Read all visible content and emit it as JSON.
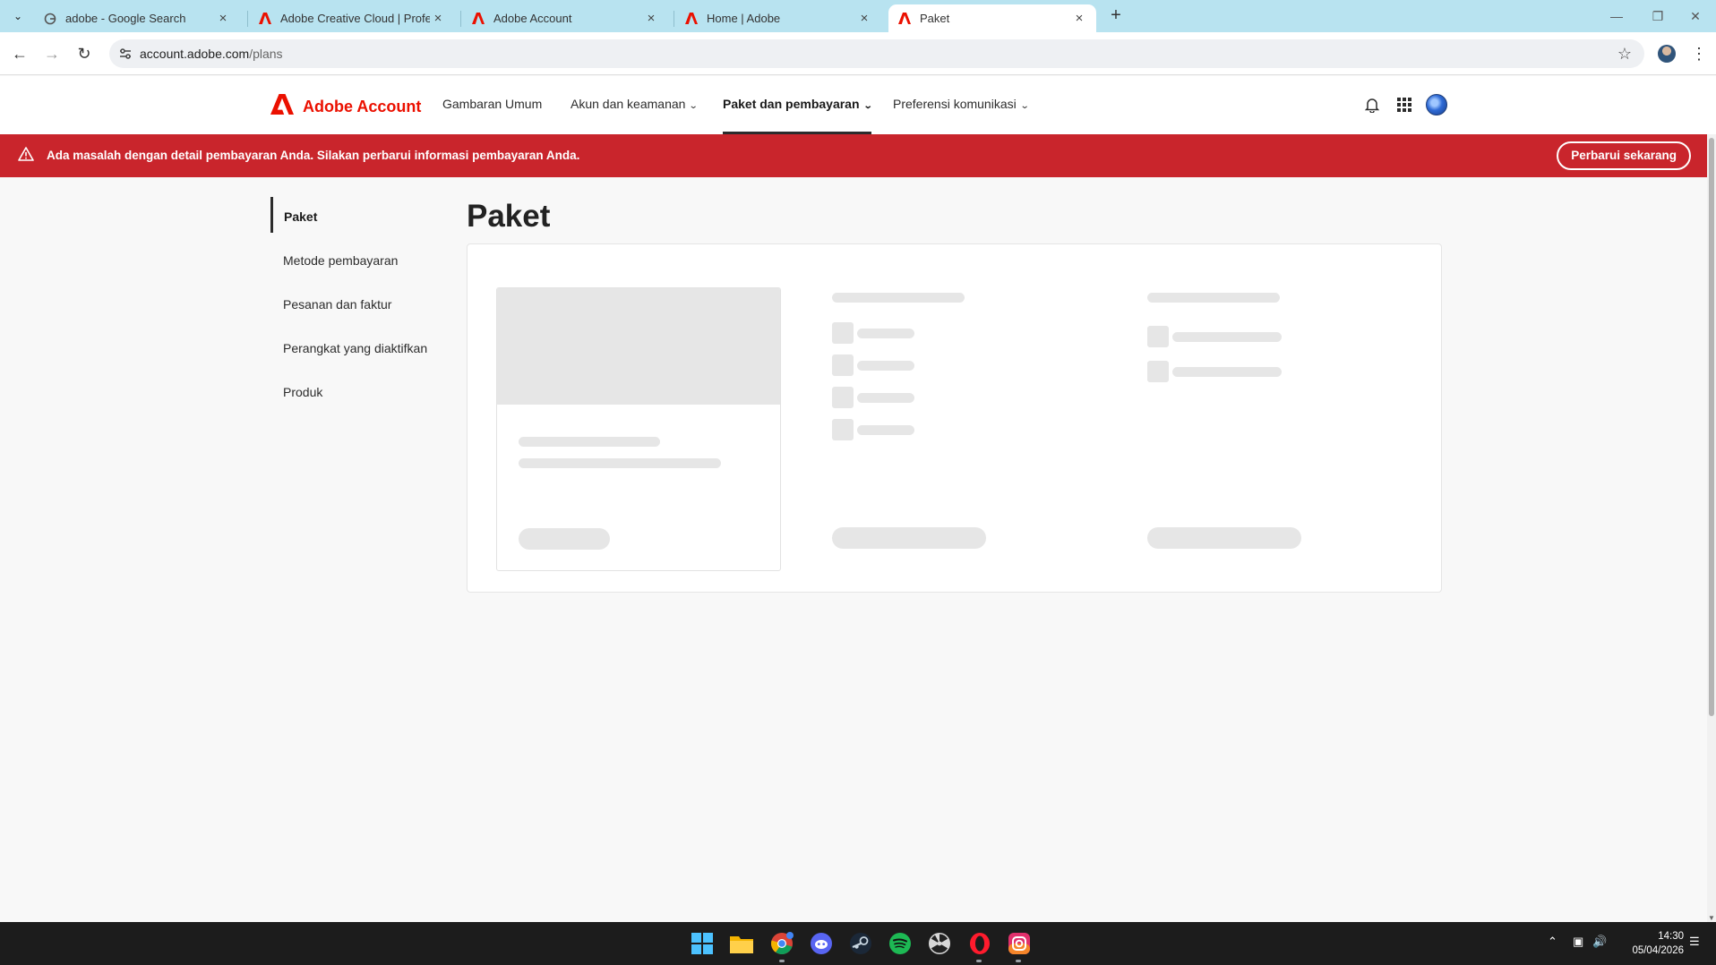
{
  "browser": {
    "tabs": [
      {
        "title": "adobe - Google Search",
        "favicon": "google-icon"
      },
      {
        "title": "Adobe Creative Cloud | Profess",
        "favicon": "adobe-icon"
      },
      {
        "title": "Adobe Account",
        "favicon": "adobe-icon"
      },
      {
        "title": "Home | Adobe",
        "favicon": "adobe-icon"
      },
      {
        "title": "Paket",
        "favicon": "adobe-icon",
        "active": true
      }
    ],
    "url_host": "account.adobe.com",
    "url_path": "/plans"
  },
  "header": {
    "brand": "Adobe Account",
    "nav": [
      {
        "label": "Gambaran Umum",
        "has_menu": false
      },
      {
        "label": "Akun dan keamanan",
        "has_menu": true
      },
      {
        "label": "Paket dan pembayaran",
        "has_menu": true,
        "active": true
      },
      {
        "label": "Preferensi komunikasi",
        "has_menu": true
      }
    ],
    "brand_color": "#eb1000"
  },
  "alert": {
    "message": "Ada masalah dengan detail pembayaran Anda. Silakan perbarui informasi pembayaran Anda.",
    "button": "Perbarui sekarang",
    "color": "#c9252c"
  },
  "sidebar": {
    "items": [
      {
        "label": "Paket",
        "active": true
      },
      {
        "label": "Metode pembayaran"
      },
      {
        "label": "Pesanan dan faktur"
      },
      {
        "label": "Perangkat yang diaktifkan"
      },
      {
        "label": "Produk"
      }
    ]
  },
  "main": {
    "title": "Paket",
    "state": "loading-skeleton"
  },
  "taskbar": {
    "apps": [
      "windows-start-icon",
      "file-explorer-icon",
      "chrome-icon",
      "discord-icon",
      "steam-icon",
      "spotify-icon",
      "radiation-app-icon",
      "opera-icon",
      "instagram-icon"
    ],
    "time": "14:30",
    "date": "05/04/2026"
  }
}
